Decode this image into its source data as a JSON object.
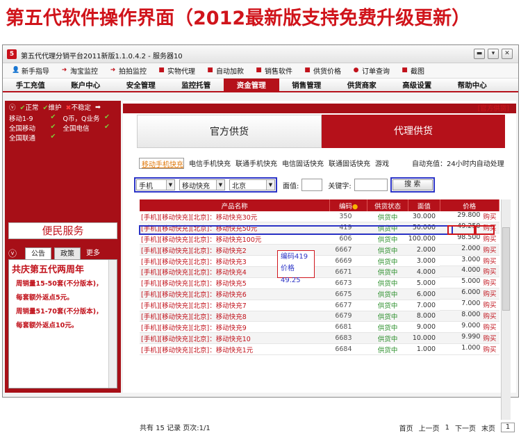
{
  "banner": "第五代软件操作界面（2012最新版支持免费升级更新）",
  "window": {
    "title": "第五代代理分销平台2011新版1.1.0.4.2 - 服务器10",
    "btns": [
      "▬",
      "▾",
      "✕"
    ]
  },
  "toolbar": [
    {
      "label": "新手指导",
      "icon": "👤",
      "color": "#c1121b"
    },
    {
      "label": "淘宝监控",
      "icon": "➜",
      "color": "#c1121b"
    },
    {
      "label": "拍拍监控",
      "icon": "➜",
      "color": "#c1121b"
    },
    {
      "label": "实物代理",
      "icon": "■",
      "color": "#c1121b"
    },
    {
      "label": "自动加款",
      "icon": "■",
      "color": "#c1121b"
    },
    {
      "label": "销售软件",
      "icon": "■",
      "color": "#c1121b"
    },
    {
      "label": "供货价格",
      "icon": "■",
      "color": "#c1121b"
    },
    {
      "label": "订单查询",
      "icon": "●",
      "color": "#c1121b"
    },
    {
      "label": "截图",
      "icon": "■",
      "color": "#c1121b"
    }
  ],
  "nav": [
    "手工充值",
    "账户中心",
    "安全管理",
    "监控托管",
    "资金管理",
    "销售管理",
    "供货商家",
    "高级设置",
    "帮助中心"
  ],
  "nav_active": 4,
  "status": {
    "items": [
      "正常",
      "维护",
      "不稳定"
    ],
    "marks": [
      "✔",
      "✔",
      "✖"
    ]
  },
  "services": [
    [
      "移动1-9",
      "Q币，Q业务"
    ],
    [
      "全国移动",
      "全国电信"
    ],
    [
      "全国联通",
      ""
    ]
  ],
  "bianmin": "便民服务",
  "notice_tabs": [
    "公告",
    "政策"
  ],
  "more": "更多",
  "notice_title": "共庆第五代两周年",
  "notice_text": [
    "周销量15-50套(不分版本)，每套额外返点5元。",
    "周销量51-70套(不分版本)，每套额外返点10元。"
  ],
  "official_tag": "[官方供货]",
  "big_tabs": [
    "官方供货",
    "代理供货"
  ],
  "cats": [
    "移动手机快充",
    "电信手机快充",
    "联通手机快充",
    "电信固话快充",
    "联通固话快充",
    "游戏"
  ],
  "auto_recharge": "自动充值：24小时内自动处理",
  "filters": {
    "type": "手机",
    "kind": "移动快充",
    "region": "北京",
    "face_label": "面值:",
    "keyword_label": "关键字:",
    "search": "搜 索"
  },
  "table_headers": [
    "产品名称",
    "编码",
    "供货状态",
    "面值",
    "价格"
  ],
  "rows": [
    {
      "name": "[手机][移动快充][北京]：移动快充30元",
      "code": "350",
      "status": "供货中",
      "face": "30.000",
      "price": "29.800",
      "buy": "购买"
    },
    {
      "name": "[手机][移动快充][北京]：移动快充50元",
      "code": "419",
      "status": "供货中",
      "face": "50.000",
      "price": "49.250",
      "buy": "购买"
    },
    {
      "name": "[手机][移动快充][北京]：移动快充100元",
      "code": "606",
      "status": "供货中",
      "face": "100.000",
      "price": "98.500",
      "buy": "购买"
    },
    {
      "name": "[手机][移动快充][北京]：移动快充2",
      "code": "6667",
      "status": "供货中",
      "face": "2.000",
      "price": "2.000",
      "buy": "购买"
    },
    {
      "name": "[手机][移动快充][北京]：移动快充3",
      "code": "6669",
      "status": "供货中",
      "face": "3.000",
      "price": "3.000",
      "buy": "购买"
    },
    {
      "name": "[手机][移动快充][北京]：移动快充4",
      "code": "6671",
      "status": "供货中",
      "face": "4.000",
      "price": "4.000",
      "buy": "购买"
    },
    {
      "name": "[手机][移动快充][北京]：移动快充5",
      "code": "6673",
      "status": "供货中",
      "face": "5.000",
      "price": "5.000",
      "buy": "购买"
    },
    {
      "name": "[手机][移动快充][北京]：移动快充6",
      "code": "6675",
      "status": "供货中",
      "face": "6.000",
      "price": "6.000",
      "buy": "购买"
    },
    {
      "name": "[手机][移动快充][北京]：移动快充7",
      "code": "6677",
      "status": "供货中",
      "face": "7.000",
      "price": "7.000",
      "buy": "购买"
    },
    {
      "name": "[手机][移动快充][北京]：移动快充8",
      "code": "6679",
      "status": "供货中",
      "face": "8.000",
      "price": "8.000",
      "buy": "购买"
    },
    {
      "name": "[手机][移动快充][北京]：移动快充9",
      "code": "6681",
      "status": "供货中",
      "face": "9.000",
      "price": "9.000",
      "buy": "购买"
    },
    {
      "name": "[手机][移动快充][北京]：移动快充10",
      "code": "6683",
      "status": "供货中",
      "face": "10.000",
      "price": "9.990",
      "buy": "购买"
    },
    {
      "name": "[手机][移动快充][北京]：移动快充1元",
      "code": "6684",
      "status": "供货中",
      "face": "1.000",
      "price": "1.000",
      "buy": "购买"
    }
  ],
  "callout": [
    "编码419",
    "价格49.25"
  ],
  "footer": {
    "left": "共有 15 记录 页次:1/1",
    "first": "首页",
    "prev": "上一页",
    "page": "1",
    "next": "下一页",
    "last": "末页",
    "input": "1"
  }
}
